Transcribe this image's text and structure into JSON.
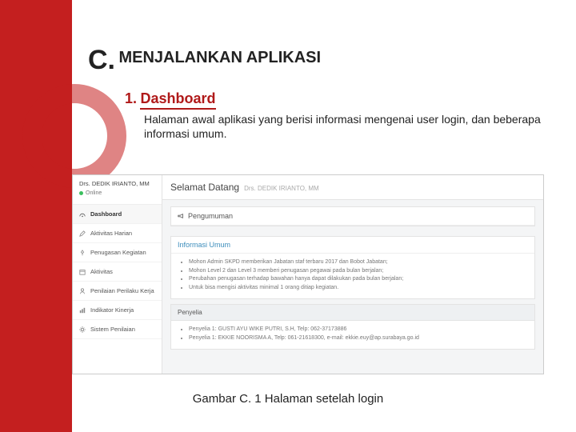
{
  "heading": {
    "prefix": "C.",
    "title": "MENJALANKAN APLIKASI"
  },
  "sub": {
    "num": "1.",
    "title": "Dashboard"
  },
  "desc": "Halaman awal aplikasi yang berisi informasi mengenai user login, dan beberapa informasi umum.",
  "caption": "Gambar C. 1 Halaman setelah login",
  "screenshot": {
    "user": {
      "name": "Drs. DEDIK IRIANTO, MM",
      "status": "Online"
    },
    "menu": [
      "Dashboard",
      "Aktivitas Harian",
      "Penugasan Kegiatan",
      "Aktivitas",
      "Penilaian Perilaku Kerja",
      "Indikator Kinerja",
      "Sistem Penilaian"
    ],
    "header": {
      "title": "Selamat Datang",
      "sub": "Drs. DEDIK IRIANTO, MM"
    },
    "announce_label": "Pengumuman",
    "info": {
      "title": "Informasi Umum",
      "items": [
        "Mohon Admin SKPD memberikan Jabatan staf terbaru 2017 dan Bobot Jabatan;",
        "Mohon Level 2 dan Level 3 memberi penugasan pegawai pada bulan berjalan;",
        "Perubahan penugasan terhadap bawahan hanya dapat dilakukan pada bulan berjalan;",
        "Untuk bisa mengisi aktivitas minimal 1 orang ditiap kegiatan."
      ]
    },
    "penyelia": {
      "title": "Penyelia",
      "items": [
        "Penyelia 1: GUSTI AYU WIKE PUTRI, S.H, Telp: 062-37173886",
        "Penyelia 1: EKKIE NOORISMA A, Telp: 061-21618300, e-mail: ekkie.euy@ap.surabaya.go.id"
      ]
    }
  }
}
